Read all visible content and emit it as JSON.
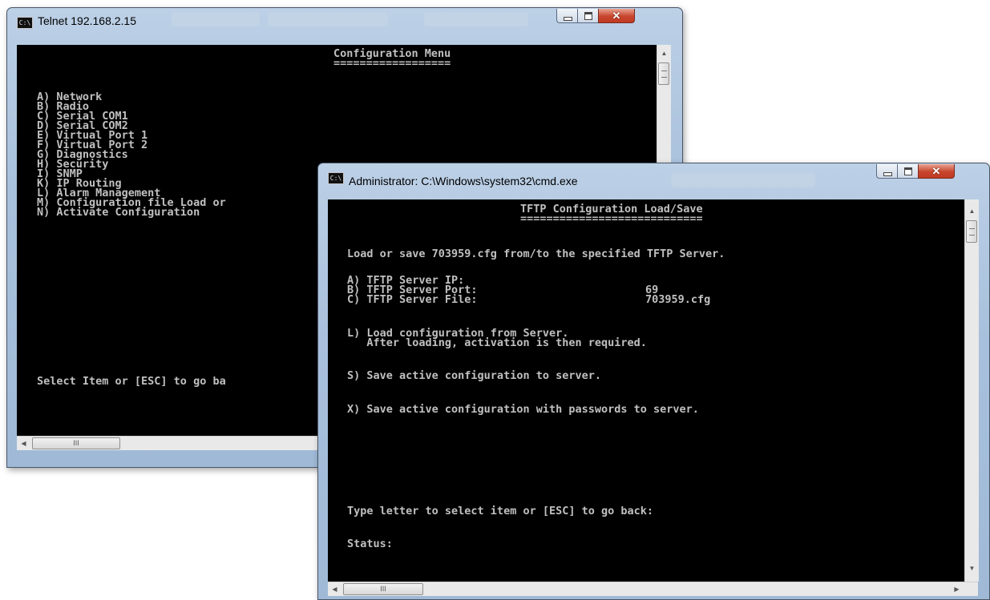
{
  "telnet_window": {
    "title": "Telnet 192.168.2.15",
    "icon": "console-icon",
    "icon_text": "C:\\",
    "heading": "Configuration Menu",
    "underline": "==================",
    "menu_items": [
      "A) Network",
      "B) Radio",
      "C) Serial COM1",
      "D) Serial COM2",
      "E) Virtual Port 1",
      "F) Virtual Port 2",
      "G) Diagnostics",
      "H) Security",
      "I) SNMP",
      "K) IP Routing",
      "L) Alarm Management",
      "M) Configuration file Load or",
      "N) Activate Configuration"
    ],
    "prompt": "Select Item or [ESC] to go ba",
    "hscroll_thumb": "III"
  },
  "cmd_window": {
    "title": "Administrator: C:\\Windows\\system32\\cmd.exe",
    "icon": "console-icon",
    "icon_text": "C:\\",
    "heading": "TFTP Configuration Load/Save",
    "underline": "============================",
    "intro": "Load or save 703959.cfg from/to the specified TFTP Server.",
    "settings": [
      {
        "label": "A) TFTP Server IP:",
        "value": ""
      },
      {
        "label": "B) TFTP Server Port:",
        "value": "69"
      },
      {
        "label": "C) TFTP Server File:",
        "value": "703959.cfg"
      }
    ],
    "load_line1": "L) Load configuration from Server.",
    "load_line2": "   After loading, activation is then required.",
    "save_line": "S) Save active configuration to server.",
    "save_pw_line": "X) Save active configuration with passwords to server.",
    "prompt": "Type letter to select item or [ESC] to go back:",
    "status_label": "Status:",
    "hscroll_thumb": "III"
  }
}
